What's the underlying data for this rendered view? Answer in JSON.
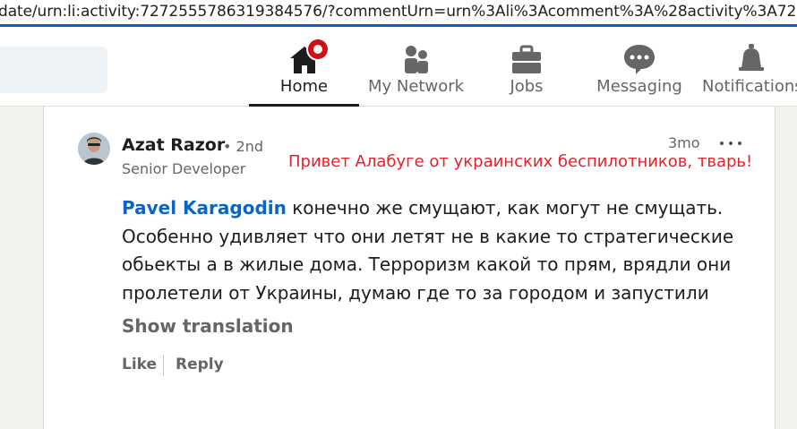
{
  "browser": {
    "url": "date/urn:li:activity:7272555786319384576/?commentUrn=urn%3Ali%3Acomment%3A%28activity%3A72725557863"
  },
  "nav": {
    "items": [
      {
        "label": "Home",
        "icon": "home-icon",
        "active": true
      },
      {
        "label": "My Network",
        "icon": "people-icon"
      },
      {
        "label": "Jobs",
        "icon": "briefcase-icon"
      },
      {
        "label": "Messaging",
        "icon": "message-bubble-icon"
      },
      {
        "label": "Notifications",
        "icon": "bell-icon"
      }
    ]
  },
  "comment": {
    "author": "Azat Razor",
    "degree": "• 2nd",
    "headline": "Senior Developer",
    "time": "3mo",
    "overlay_text": "Привет Алабуге от украинских беспилотников, тварь!",
    "mention": "Pavel Karagodin",
    "text": " конечно же смущают, как могут не смущать. Особенно удивляет что они летят не в какие то стратегические обьекты а в жилые дома. Терроризм какой то прям, врядли они пролетели от Украины, думаю где то за городом и запустили",
    "show_translation": "Show translation",
    "like_label": "Like",
    "reply_label": "Reply"
  },
  "colors": {
    "accent": "#0a66c2",
    "notification_badge": "#cc1016",
    "overlay_text": "#e8202a"
  }
}
